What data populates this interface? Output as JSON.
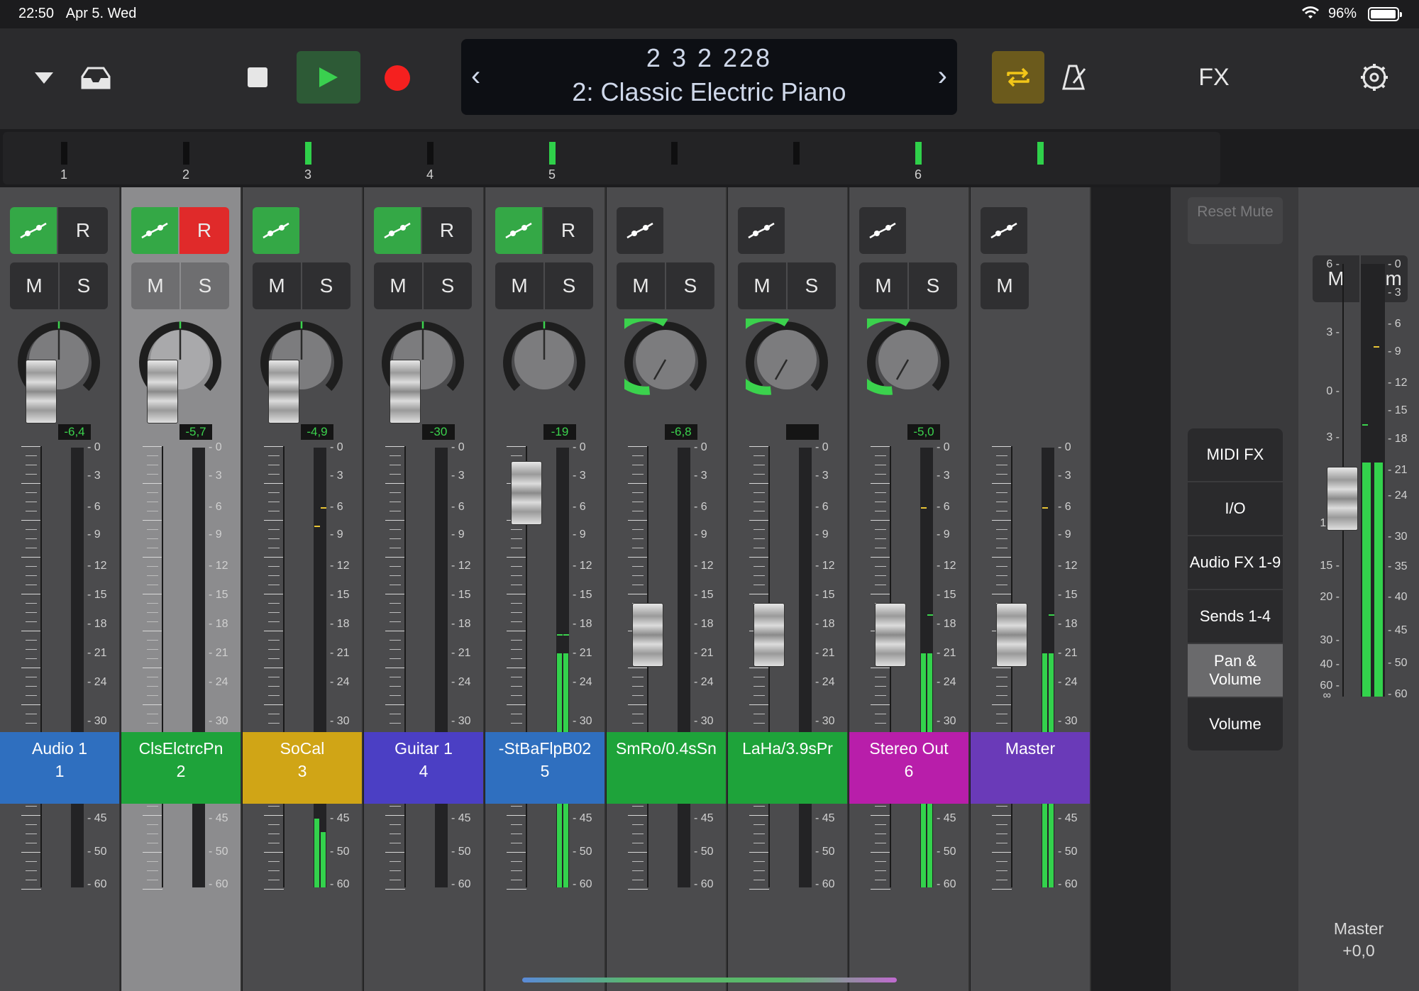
{
  "status": {
    "time": "22:50",
    "date": "Apr 5. Wed",
    "battery": "96%",
    "battery_level": 0.96
  },
  "toolbar": {
    "fx_label": "FX"
  },
  "lcd": {
    "position": "2  3  2  228",
    "patch": "2: Classic Electric Piano",
    "prev": "‹",
    "next": "›"
  },
  "navstrip": {
    "numbers": [
      "1",
      "2",
      "3",
      "4",
      "5",
      "6"
    ]
  },
  "channels": [
    {
      "name": "Audio 1",
      "num": "1",
      "color": "#2f6fbf",
      "vol": "-6,4",
      "rec": true,
      "selected": false,
      "pan": "center"
    },
    {
      "name": "ClsElctrcPn",
      "num": "2",
      "color": "#1ea33a",
      "vol": "-5,7",
      "rec": true,
      "rec_on": true,
      "selected": true,
      "pan": "center"
    },
    {
      "name": "SoCal",
      "num": "3",
      "color": "#d0a516",
      "vol": "-4,9",
      "rec": false,
      "selected": false,
      "pan": "center"
    },
    {
      "name": "Guitar 1",
      "num": "4",
      "color": "#4b3fc4",
      "vol": "-30",
      "rec": true,
      "selected": false,
      "pan": "center"
    },
    {
      "name": "-StBaFlpB02",
      "num": "5",
      "color": "#2f6fbf",
      "vol": "-19",
      "rec": true,
      "selected": false,
      "pan": "center"
    },
    {
      "name": "SmRo/0.4sSn",
      "num": "",
      "color": "#1ea33a",
      "vol": "-6,8",
      "rec": false,
      "selected": false,
      "pan": "send"
    },
    {
      "name": "LaHa/3.9sPr",
      "num": "",
      "color": "#1ea33a",
      "vol": "",
      "rec": false,
      "selected": false,
      "pan": "send"
    },
    {
      "name": "Stereo Out",
      "num": "6",
      "color": "#b81eaa",
      "vol": "-5,0",
      "rec": false,
      "selected": false,
      "pan": "send"
    },
    {
      "name": "Master",
      "num": "",
      "color": "#6a3ab8",
      "vol": "",
      "rec": false,
      "selected": false,
      "pan": "none"
    }
  ],
  "buttons": {
    "rec": "R",
    "mute": "M",
    "solo": "S"
  },
  "scale": [
    "0",
    "3",
    "6",
    "9",
    "12",
    "15",
    "18",
    "21",
    "24",
    "30",
    "35",
    "40",
    "45",
    "50",
    "60"
  ],
  "right_panel": {
    "reset_mute": "Reset Mute",
    "menu": [
      "MIDI FX",
      "I/O",
      "Audio FX 1-9",
      "Sends 1-4",
      "Pan & Volume",
      "Volume"
    ],
    "active_index": 4
  },
  "master": {
    "mute": "M",
    "dim": "Dim",
    "name": "Master",
    "value": "+0,0",
    "left_scale": [
      "6",
      "3",
      "0",
      "3",
      "6",
      "10",
      "15",
      "20",
      "30",
      "40",
      "60"
    ],
    "inf": "∞",
    "right_scale": [
      "0",
      "3",
      "6",
      "9",
      "12",
      "15",
      "18",
      "21",
      "24",
      "30",
      "35",
      "40",
      "45",
      "50",
      "60"
    ]
  }
}
